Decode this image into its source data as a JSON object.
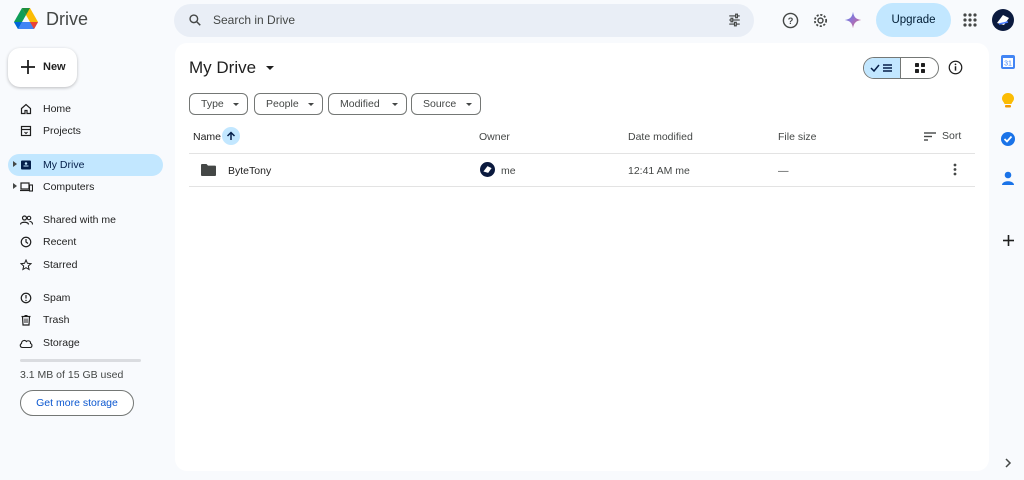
{
  "app": {
    "name": "Drive"
  },
  "search": {
    "placeholder": "Search in Drive"
  },
  "header": {
    "upgrade_label": "Upgrade"
  },
  "sidebar": {
    "new_label": "New",
    "items": [
      {
        "label": "Home"
      },
      {
        "label": "Projects"
      },
      {
        "label": "My Drive"
      },
      {
        "label": "Computers"
      },
      {
        "label": "Shared with me"
      },
      {
        "label": "Recent"
      },
      {
        "label": "Starred"
      },
      {
        "label": "Spam"
      },
      {
        "label": "Trash"
      },
      {
        "label": "Storage"
      }
    ],
    "storage_text": "3.1 MB of 15 GB used",
    "storage_fraction": 0.0002,
    "get_storage_label": "Get more storage"
  },
  "main": {
    "title": "My Drive",
    "filters": [
      "Type",
      "People",
      "Modified",
      "Source"
    ],
    "columns": {
      "name": "Name",
      "owner": "Owner",
      "date": "Date modified",
      "size": "File size",
      "sort": "Sort"
    },
    "rows": [
      {
        "name": "ByteTony",
        "owner": "me",
        "date": "12:41 AM me",
        "size": "—"
      }
    ]
  },
  "right_rail": {
    "calendar_day": "31"
  },
  "colors": {
    "accent": "#c2e7ff",
    "link": "#0b57d0",
    "background": "#f8fafd"
  }
}
